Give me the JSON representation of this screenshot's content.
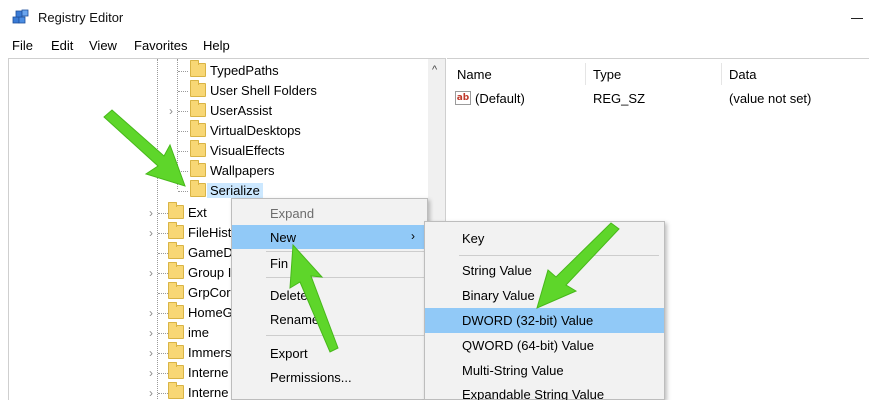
{
  "window": {
    "title": "Registry Editor",
    "icon": "registry-editor-icon"
  },
  "menubar": {
    "items": [
      "File",
      "Edit",
      "View",
      "Favorites",
      "Help"
    ]
  },
  "tree": {
    "items": [
      {
        "label": "TypedPaths"
      },
      {
        "label": "User Shell Folders"
      },
      {
        "label": "UserAssist"
      },
      {
        "label": "VirtualDesktops"
      },
      {
        "label": "VisualEffects"
      },
      {
        "label": "Wallpapers"
      },
      {
        "label": "Serialize"
      },
      {
        "label": "Ext"
      },
      {
        "label": "FileHist"
      },
      {
        "label": "GameD"
      },
      {
        "label": "Group I"
      },
      {
        "label": "GrpCor"
      },
      {
        "label": "HomeG"
      },
      {
        "label": "ime"
      },
      {
        "label": "Immers"
      },
      {
        "label": "Interne"
      },
      {
        "label": "Interne"
      }
    ],
    "selected": "Serialize"
  },
  "values": {
    "columns": [
      "Name",
      "Type",
      "Data"
    ],
    "rows": [
      {
        "name": "(Default)",
        "type": "REG_SZ",
        "data": "(value not set)",
        "icon": "string-value-icon"
      }
    ]
  },
  "context_menu": {
    "items": [
      {
        "label": "Expand",
        "disabled": true
      },
      {
        "label": "New",
        "hover": true,
        "submenu_arrow": "›"
      },
      {
        "label": "Fin"
      },
      {
        "label": "Delete"
      },
      {
        "label": "Rename"
      },
      {
        "label": "Export"
      },
      {
        "label": "Permissions..."
      }
    ]
  },
  "new_submenu": {
    "items": [
      {
        "label": "Key"
      },
      {
        "label": "String Value"
      },
      {
        "label": "Binary Value"
      },
      {
        "label": "DWORD (32-bit) Value",
        "hover": true
      },
      {
        "label": "QWORD (64-bit) Value"
      },
      {
        "label": "Multi-String Value"
      },
      {
        "label": "Expandable String Value"
      }
    ]
  },
  "colors": {
    "highlight": "#91c9f7",
    "selection": "#cce8ff",
    "folder": "#f8d775",
    "annotation_arrow": "#5ed62a"
  }
}
